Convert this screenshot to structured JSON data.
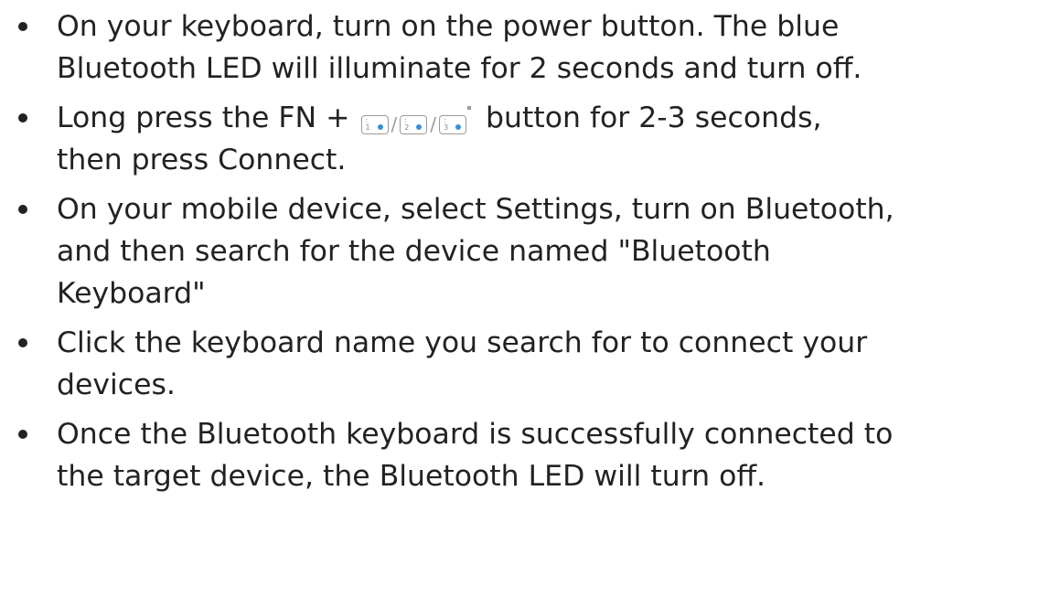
{
  "instructions": {
    "items": [
      {
        "lines": [
          "On your keyboard, turn on the power button. The blue",
          "Bluetooth LED will illuminate for 2 seconds and turn off."
        ]
      },
      {
        "line1_before": "Long press the FN +",
        "line1_after": "button for 2-3 seconds,",
        "line2": "then press Connect.",
        "keys": [
          {
            "top": ":",
            "bottom": "1",
            "icon": "bluetooth-channel-1-key-icon"
          },
          {
            "top": ":",
            "bottom": "2",
            "icon": "bluetooth-channel-2-key-icon"
          },
          {
            "top": ":",
            "bottom": "3",
            "icon": "bluetooth-channel-3-key-icon"
          }
        ],
        "separator": "/"
      },
      {
        "lines": [
          "On your mobile device, select Settings, turn on Bluetooth,",
          "and then search for the device named \"Bluetooth",
          "Keyboard\""
        ]
      },
      {
        "lines": [
          "Click the keyboard name you search for to connect your",
          "devices."
        ]
      },
      {
        "lines": [
          "Once the Bluetooth keyboard is successfully connected to",
          "the target device, the Bluetooth LED will turn off."
        ]
      }
    ]
  },
  "colors": {
    "text": "#222222",
    "key_led": "#3a8fd6",
    "key_outline": "#9a9a9a"
  }
}
